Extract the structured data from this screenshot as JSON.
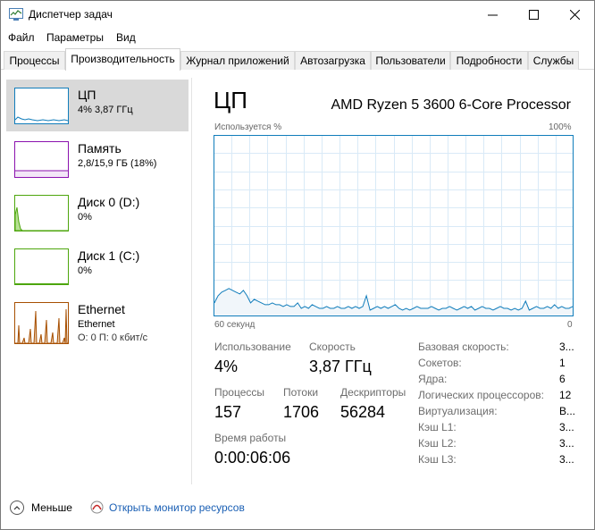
{
  "window": {
    "title": "Диспетчер задач",
    "controls": {
      "minimize": "—",
      "maximize": "☐",
      "close": "✕"
    }
  },
  "menu": [
    "Файл",
    "Параметры",
    "Вид"
  ],
  "tabs": [
    "Процессы",
    "Производительность",
    "Журнал приложений",
    "Автозагрузка",
    "Пользователи",
    "Подробности",
    "Службы"
  ],
  "active_tab": "Производительность",
  "sidebar": [
    {
      "title": "ЦП",
      "sub": "4% 3,87 ГГц",
      "color": "#117dbb"
    },
    {
      "title": "Память",
      "sub": "2,8/15,9 ГБ (18%)",
      "color": "#8b12ae"
    },
    {
      "title": "Диск 0 (D:)",
      "sub": "0%",
      "color": "#4da60c"
    },
    {
      "title": "Диск 1 (C:)",
      "sub": "0%",
      "color": "#4da60c"
    },
    {
      "title": "Ethernet",
      "sub": "Ethernet",
      "sub2": "О: 0 П: 0 кбит/с",
      "color": "#a74f01"
    }
  ],
  "cpu": {
    "title": "ЦП",
    "model": "AMD Ryzen 5 3600 6-Core Processor",
    "graph_label": "Используется %",
    "graph_max": "100%",
    "graph_time": "60 секунд",
    "graph_zero": "0",
    "usage_history": [
      7,
      11,
      13,
      14,
      15,
      14,
      13,
      12,
      14,
      11,
      7,
      9,
      8,
      7,
      6,
      6,
      7,
      6,
      6,
      5,
      6,
      5,
      5,
      7,
      4,
      5,
      4,
      6,
      5,
      4,
      4,
      5,
      4,
      4,
      5,
      4,
      4,
      5,
      4,
      5,
      4,
      5,
      11,
      3,
      4,
      5,
      4,
      5,
      4,
      5,
      6,
      4,
      3,
      4,
      3,
      4,
      5,
      4,
      4,
      4,
      5,
      4,
      3,
      4,
      4,
      5,
      4,
      3,
      4,
      5,
      4,
      5,
      3,
      4,
      5,
      4,
      4,
      3,
      4,
      5,
      4,
      4,
      3,
      4,
      3,
      4,
      8,
      3,
      4,
      5,
      4,
      4,
      5,
      4,
      6,
      4,
      5,
      4,
      4,
      5
    ],
    "stats": {
      "usage_label": "Использование",
      "usage": "4%",
      "speed_label": "Скорость",
      "speed": "3,87 ГГц",
      "processes_label": "Процессы",
      "processes": "157",
      "threads_label": "Потоки",
      "threads": "1706",
      "handles_label": "Дескрипторы",
      "handles": "56284",
      "uptime_label": "Время работы",
      "uptime": "0:00:06:06"
    },
    "specs": [
      {
        "label": "Базовая скорость:",
        "value": "3..."
      },
      {
        "label": "Сокетов:",
        "value": "1"
      },
      {
        "label": "Ядра:",
        "value": "6"
      },
      {
        "label": "Логических процессоров:",
        "value": "12"
      },
      {
        "label": "Виртуализация:",
        "value": "В..."
      },
      {
        "label": "Кэш L1:",
        "value": "3..."
      },
      {
        "label": "Кэш L2:",
        "value": "3..."
      },
      {
        "label": "Кэш L3:",
        "value": "3..."
      }
    ]
  },
  "footer": {
    "fewer": "Меньше",
    "resource_monitor": "Открыть монитор ресурсов"
  }
}
